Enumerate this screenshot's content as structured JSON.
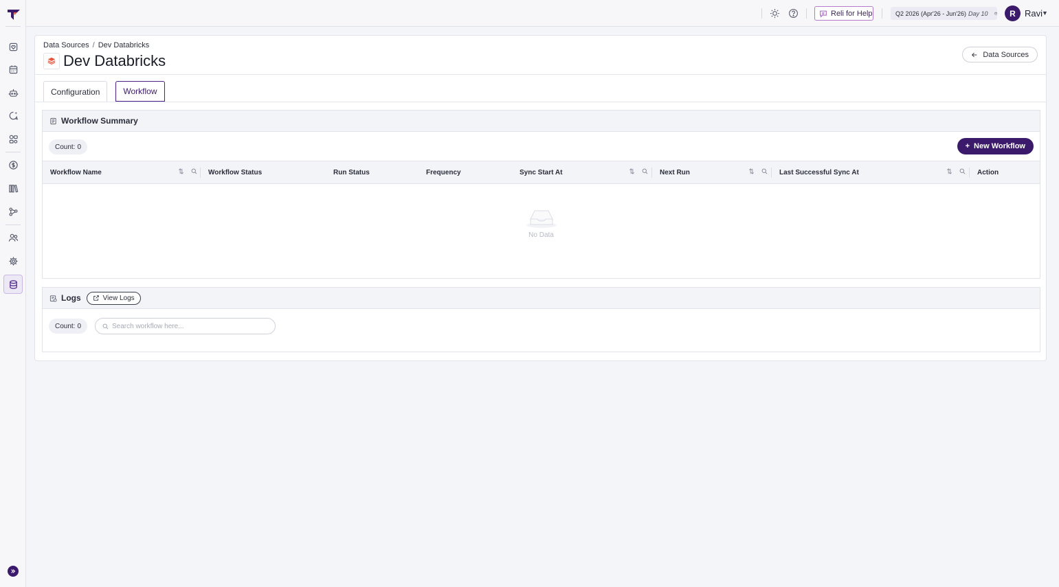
{
  "header": {
    "help_label": "Reli for Help",
    "quarter_label": "Q2 2026 (Apr'26 - Jun'26)",
    "quarter_day": "Day 10",
    "user_initial": "R",
    "user_name": "Ravi"
  },
  "sidebar": {
    "items": [
      {
        "icon": "shield-heart-icon"
      },
      {
        "icon": "calendar-icon"
      },
      {
        "icon": "robot-icon"
      },
      {
        "icon": "chat-sparkle-icon"
      },
      {
        "icon": "org-chart-icon"
      },
      {
        "icon": "dollar-icon"
      },
      {
        "icon": "library-icon"
      },
      {
        "icon": "flow-icon"
      },
      {
        "icon": "people-icon"
      },
      {
        "icon": "settings-gear-icon"
      },
      {
        "icon": "database-icon",
        "active": true
      }
    ]
  },
  "breadcrumb": {
    "root": "Data Sources",
    "separator": "/",
    "current": "Dev Databricks"
  },
  "page": {
    "title": "Dev Databricks",
    "back_label": "Data Sources"
  },
  "tabs": [
    {
      "label": "Configuration",
      "active": false
    },
    {
      "label": "Workflow",
      "active": true
    }
  ],
  "workflow_summary": {
    "title": "Workflow Summary",
    "count_label": "Count:",
    "count_value": "0",
    "new_button": "New Workflow",
    "columns": [
      {
        "label": "Workflow Name",
        "sortable": true,
        "searchable": true
      },
      {
        "label": "Workflow Status",
        "sortable": false,
        "searchable": false
      },
      {
        "label": "Run Status",
        "sortable": false,
        "searchable": false
      },
      {
        "label": "Frequency",
        "sortable": false,
        "searchable": false
      },
      {
        "label": "Sync Start At",
        "sortable": true,
        "searchable": true
      },
      {
        "label": "Next Run",
        "sortable": true,
        "searchable": true
      },
      {
        "label": "Last Successful Sync At",
        "sortable": true,
        "searchable": true
      },
      {
        "label": "Action",
        "sortable": false,
        "searchable": false
      }
    ],
    "rows": [],
    "empty_text": "No Data"
  },
  "logs": {
    "title": "Logs",
    "view_button": "View Logs",
    "count_label": "Count:",
    "count_value": "0",
    "search_placeholder": "Search workflow here...",
    "search_value": ""
  },
  "colors": {
    "brand": "#3b1a6b",
    "help_border": "#b67acb",
    "databricks": "#e8553c"
  }
}
